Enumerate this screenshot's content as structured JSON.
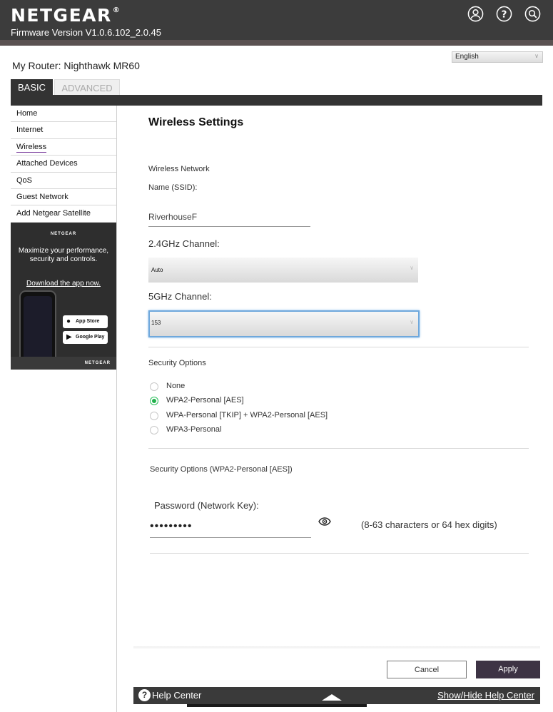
{
  "header": {
    "brand": "NETGEAR",
    "trademark": "®",
    "firmware": "Firmware Version V1.0.6.102_2.0.45",
    "icons": [
      "user-icon",
      "help-icon",
      "search-icon"
    ]
  },
  "router": {
    "label": "My Router: Nighthawk MR60",
    "language": "English"
  },
  "tabs": [
    {
      "label": "BASIC",
      "active": true
    },
    {
      "label": "ADVANCED",
      "active": false
    }
  ],
  "sidebar": {
    "items": [
      {
        "label": "Home"
      },
      {
        "label": "Internet"
      },
      {
        "label": "Wireless",
        "active": true
      },
      {
        "label": "Attached Devices"
      },
      {
        "label": "QoS"
      },
      {
        "label": "Guest Network"
      },
      {
        "label": "Add Netgear Satellite"
      }
    ]
  },
  "ad": {
    "brand": "NETGEAR",
    "text": "Maximize your performance, security and controls.",
    "link": "Download the app now.",
    "app_store": "App Store",
    "google_play": "Google Play",
    "footer_brand": "NETGEAR"
  },
  "main": {
    "title": "Wireless Settings",
    "network_heading": "Wireless Network",
    "ssid_label": "Name (SSID):",
    "ssid_value": "RiverhouseF",
    "channel_24_label": "2.4GHz Channel:",
    "channel_24_value": "Auto",
    "channel_5_label": "5GHz Channel:",
    "channel_5_value": "153",
    "security_heading": "Security Options",
    "security_options": [
      {
        "label": "None",
        "checked": false
      },
      {
        "label": "WPA2-Personal [AES]",
        "checked": true
      },
      {
        "label": "WPA-Personal [TKIP] + WPA2-Personal [AES]",
        "checked": false
      },
      {
        "label": "WPA3-Personal",
        "checked": false
      }
    ],
    "security_detail_heading": "Security Options (WPA2-Personal [AES])",
    "password_label": "Password (Network Key):",
    "password_value": "•••••••••",
    "password_hint": "(8-63 characters or 64 hex digits)"
  },
  "footer": {
    "cancel": "Cancel",
    "apply": "Apply",
    "help_center": "Help Center",
    "help_toggle": "Show/Hide Help Center"
  },
  "colors": {
    "header_bg": "#3c3c3c",
    "accent_green": "#22b14c",
    "apply_bg": "#3d3344",
    "focus_blue": "#6fa8dc"
  }
}
